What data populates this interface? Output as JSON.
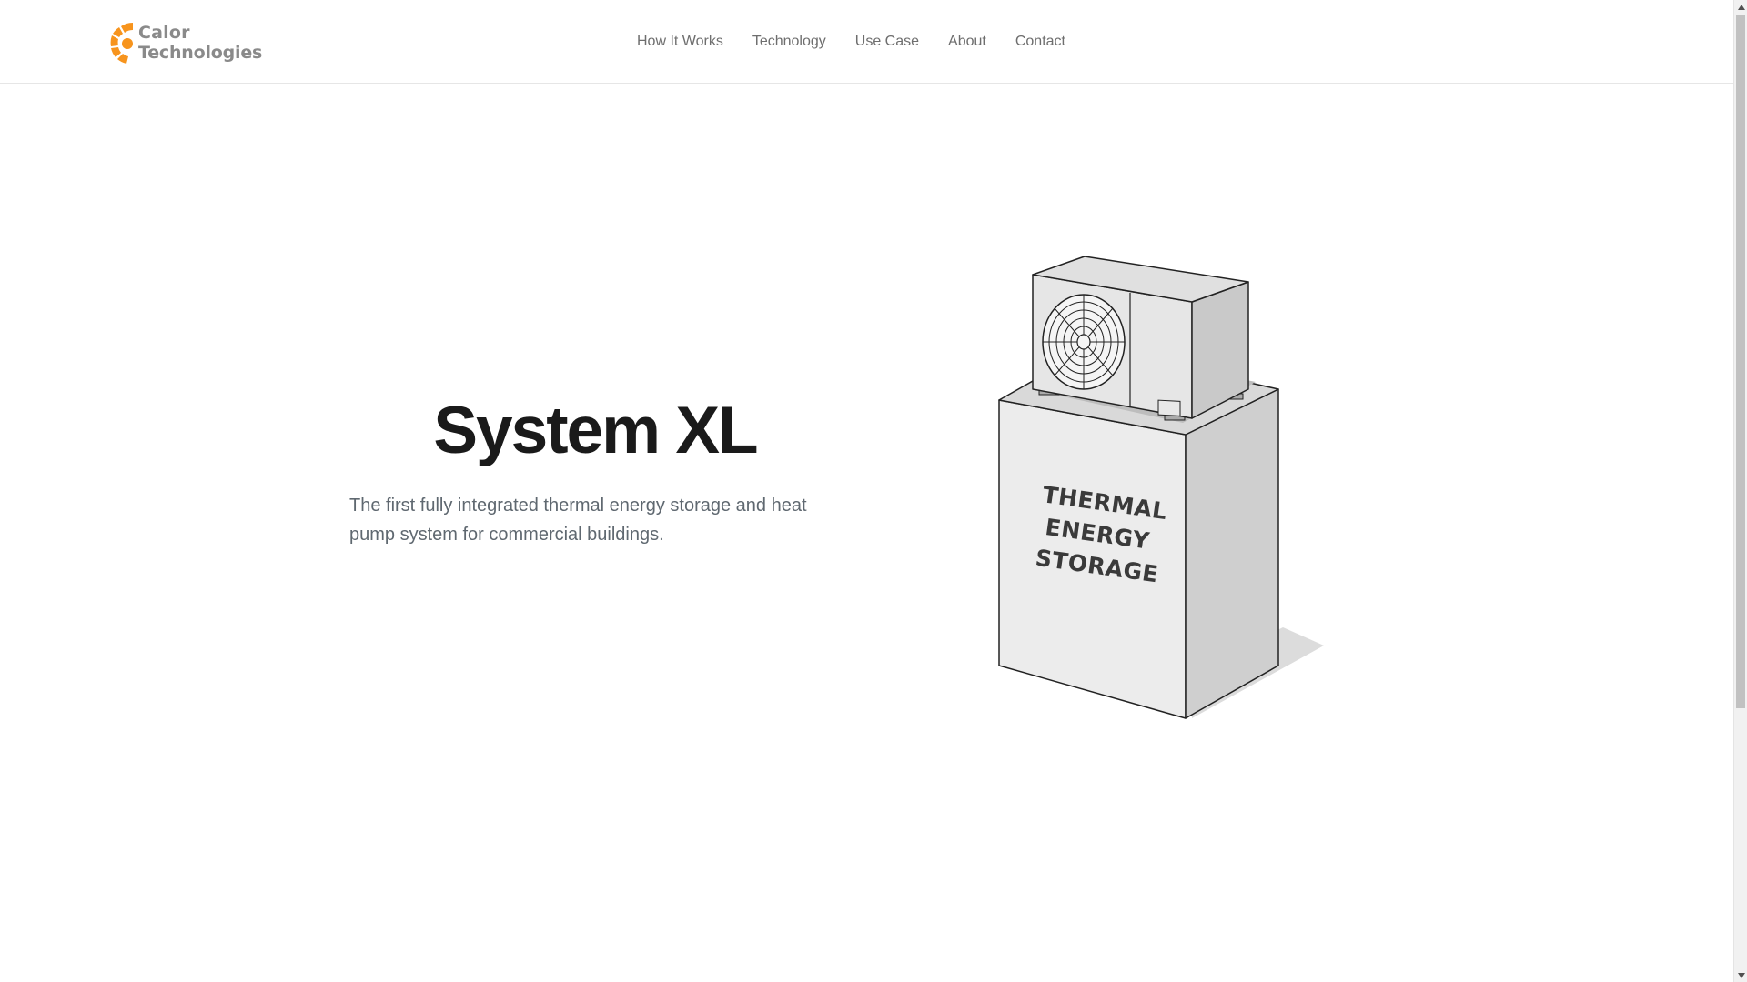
{
  "brand": {
    "name_line1": "Calor",
    "name_line2": "Technologies",
    "accent_color": "#F7941D",
    "text_color": "#8A8A8A",
    "logo_icon": "sun-arc-logo-icon"
  },
  "nav": {
    "items": [
      {
        "label": "How It Works"
      },
      {
        "label": "Technology"
      },
      {
        "label": "Use Case"
      },
      {
        "label": "About"
      },
      {
        "label": "Contact"
      }
    ]
  },
  "hero": {
    "title": "System XL",
    "subtitle": "The first fully integrated thermal energy storage and heat pump system for commercial buildings.",
    "illustration": {
      "icon": "heat-pump-on-storage-tank-illustration",
      "label_lines": [
        "THERMAL",
        "ENERGY",
        "STORAGE"
      ]
    }
  },
  "scrollbar": {
    "up_icon": "scroll-up-arrow-icon",
    "down_icon": "scroll-down-arrow-icon"
  }
}
